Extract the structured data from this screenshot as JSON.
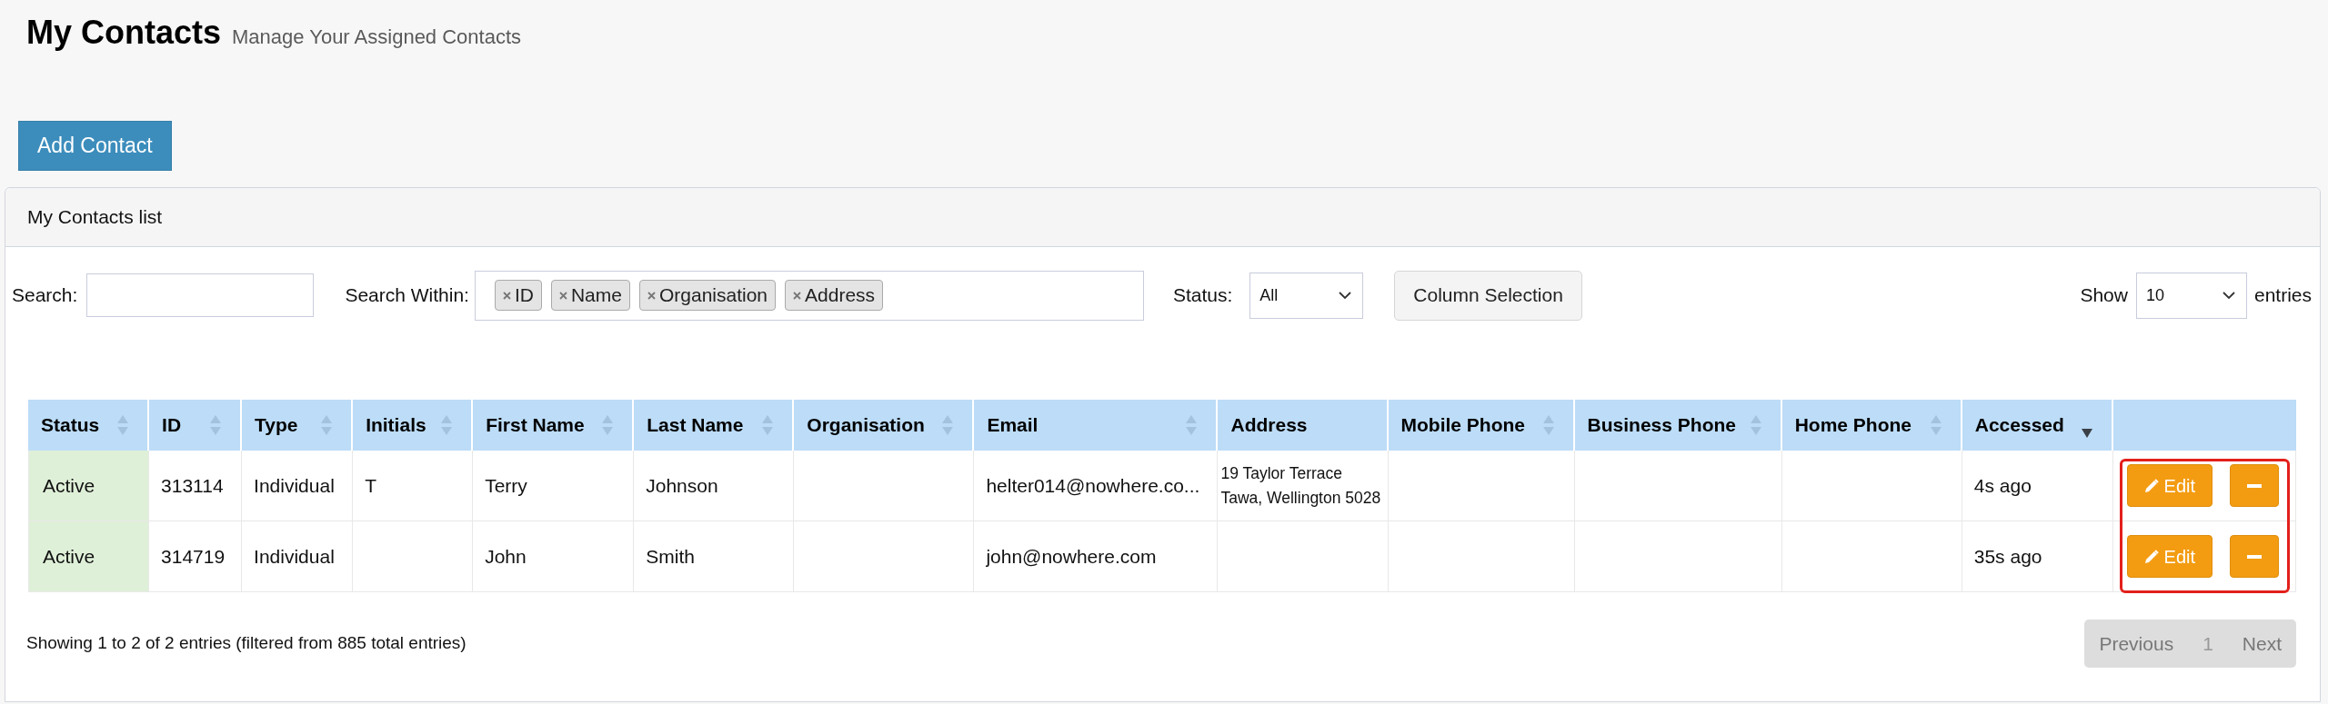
{
  "page": {
    "title": "My Contacts",
    "subtitle": "Manage Your Assigned Contacts"
  },
  "add_button": {
    "label": "Add Contact"
  },
  "panel": {
    "title": "My Contacts list"
  },
  "filters": {
    "search": {
      "label": "Search:"
    },
    "search_within": {
      "label": "Search Within:",
      "tags": [
        {
          "label": "ID"
        },
        {
          "label": "Name"
        },
        {
          "label": "Organisation"
        },
        {
          "label": "Address"
        }
      ]
    },
    "status": {
      "label": "Status:",
      "value": "All"
    },
    "column_selection": {
      "label": "Column Selection"
    },
    "page_size": {
      "label_before": "Show",
      "value": "10",
      "label_after": "entries"
    }
  },
  "table": {
    "columns": [
      {
        "label": "Status",
        "kind": "status",
        "sortable": true,
        "sorted_descending": false
      },
      {
        "label": "ID",
        "kind": "text",
        "sortable": true,
        "sorted_descending": false
      },
      {
        "label": "Type",
        "kind": "text",
        "sortable": true,
        "sorted_descending": false
      },
      {
        "label": "Initials",
        "kind": "text",
        "sortable": true,
        "sorted_descending": false
      },
      {
        "label": "First Name",
        "kind": "text",
        "sortable": true,
        "sorted_descending": false
      },
      {
        "label": "Last Name",
        "kind": "text",
        "sortable": true,
        "sorted_descending": false
      },
      {
        "label": "Organisation",
        "kind": "text",
        "sortable": true,
        "sorted_descending": false
      },
      {
        "label": "Email",
        "kind": "text",
        "sortable": true,
        "sorted_descending": false
      },
      {
        "label": "Address",
        "kind": "address",
        "sortable": false
      },
      {
        "label": "Mobile Phone",
        "kind": "text",
        "sortable": true,
        "sorted_descending": false
      },
      {
        "label": "Business Phone",
        "kind": "text",
        "sortable": true,
        "sorted_descending": false
      },
      {
        "label": "Home Phone",
        "kind": "text",
        "sortable": true,
        "sorted_descending": false
      },
      {
        "label": "Accessed",
        "kind": "text",
        "sortable": true,
        "sorted_descending": true
      },
      {
        "kind": "actions",
        "sortable": false
      }
    ],
    "rows": [
      {
        "cells": [
          "Active",
          "313114",
          "Individual",
          "T",
          "Terry",
          "Johnson",
          null,
          "helter014@nowhere.co...",
          "19 Taylor Terrace\nTawa, Wellington 5028",
          null,
          null,
          null,
          "4s ago"
        ],
        "actions": [
          {
            "kind": "edit",
            "label": "Edit"
          },
          {
            "kind": "remove"
          }
        ]
      },
      {
        "cells": [
          "Active",
          "314719",
          "Individual",
          null,
          "John",
          "Smith",
          null,
          "john@nowhere.com",
          null,
          null,
          null,
          null,
          "35s ago"
        ],
        "actions": [
          {
            "kind": "edit",
            "label": "Edit"
          },
          {
            "kind": "remove"
          }
        ]
      }
    ],
    "actions_highlighted": true
  },
  "footer": {
    "info": "Showing 1 to 2 of 2 entries (filtered from 885 total entries)",
    "pagination": {
      "previous": {
        "label": "Previous",
        "disabled": true
      },
      "pages": [
        {
          "label": "1",
          "selected": true
        }
      ],
      "next": {
        "label": "Next",
        "disabled": true
      }
    }
  }
}
